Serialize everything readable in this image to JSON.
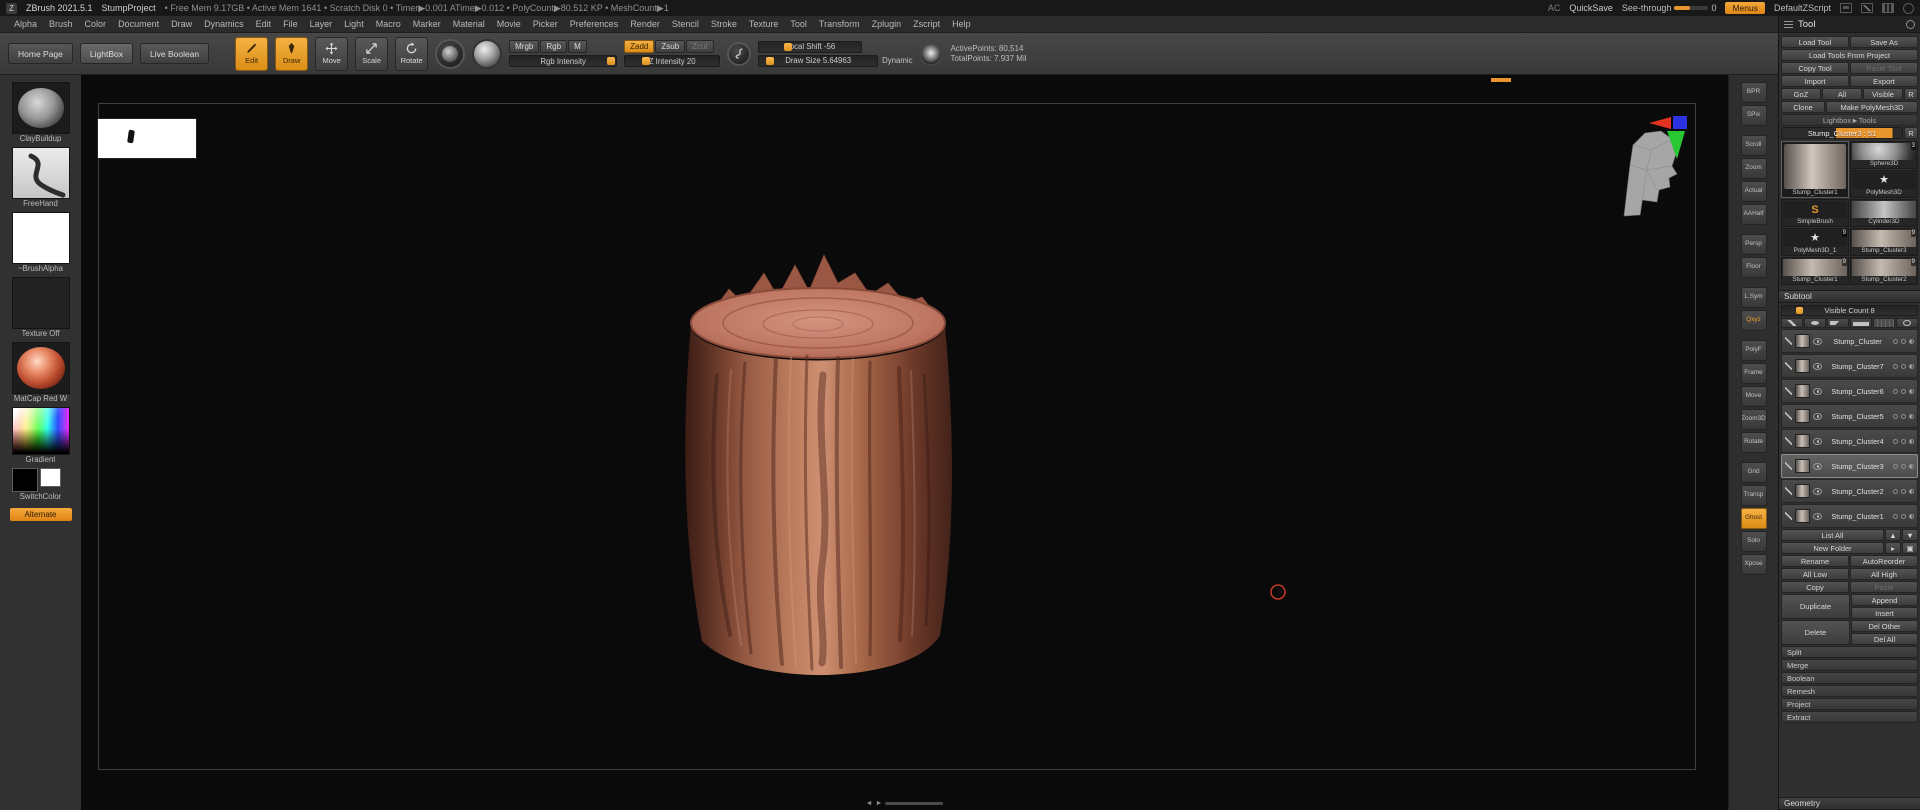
{
  "colors": {
    "accent": "#e8952e",
    "canvas_bg": "#0a0a0a",
    "model_color": "#b5704f"
  },
  "titlebar": {
    "logo": "Z",
    "app_title": "ZBrush 2021.5.1",
    "project": "StumpProject",
    "stats": "• Free Mem 9.17GB • Active Mem 1641 • Scratch Disk 0 • Timer▶0.001 ATime▶0.012 • PolyCount▶80.512 KP • MeshCount▶1",
    "ac": "AC",
    "quicksave": "QuickSave",
    "see_through": "See-through",
    "see_through_value": "0",
    "menus": "Menus",
    "default_zscript": "DefaultZScript"
  },
  "menubar": {
    "items": [
      {
        "label": "Alpha"
      },
      {
        "label": "Brush"
      },
      {
        "label": "Color"
      },
      {
        "label": "Document"
      },
      {
        "label": "Draw"
      },
      {
        "label": "Dynamics"
      },
      {
        "label": "Edit"
      },
      {
        "label": "File"
      },
      {
        "label": "Layer"
      },
      {
        "label": "Light"
      },
      {
        "label": "Macro"
      },
      {
        "label": "Marker"
      },
      {
        "label": "Material"
      },
      {
        "label": "Movie"
      },
      {
        "label": "Picker"
      },
      {
        "label": "Preferences"
      },
      {
        "label": "Render"
      },
      {
        "label": "Stencil"
      },
      {
        "label": "Stroke"
      },
      {
        "label": "Texture"
      },
      {
        "label": "Tool"
      },
      {
        "label": "Transform"
      },
      {
        "label": "Zplugin"
      },
      {
        "label": "Zscript"
      },
      {
        "label": "Help"
      }
    ]
  },
  "toolbar": {
    "home_page": "Home Page",
    "lightbox": "LightBox",
    "live_boolean": "Live Boolean",
    "modes": [
      {
        "label": "Edit",
        "state": "active"
      },
      {
        "label": "Draw",
        "state": "active"
      },
      {
        "label": "Move",
        "state": ""
      },
      {
        "label": "Scale",
        "state": ""
      },
      {
        "label": "Rotate",
        "state": ""
      }
    ],
    "mrgb": "Mrgb",
    "rgb": "Rgb",
    "m": "M",
    "rgb_intensity": "Rgb Intensity",
    "zadd": "Zadd",
    "zsub": "Zsub",
    "zcut": "Zcut",
    "z_intensity": "Z Intensity 20",
    "focal_shift": "Focal Shift -56",
    "draw_size": "Draw Size 5.64963",
    "dynamic": "Dynamic",
    "active_points": "ActivePoints: 80,514",
    "total_points": "TotalPoints: 7.937 Mil"
  },
  "left_shelf": {
    "items": [
      {
        "label": "ClayBuildup"
      },
      {
        "label": "FreeHand"
      },
      {
        "label": "~BrushAlpha"
      },
      {
        "label": "Texture Off"
      },
      {
        "label": "MatCap Red W"
      },
      {
        "label": "Gradient"
      },
      {
        "label": "SwitchColor"
      },
      {
        "label": "Alternate"
      }
    ]
  },
  "right_shelf": {
    "items": [
      {
        "label": "BPR",
        "cls": ""
      },
      {
        "label": "SPix",
        "cls": ""
      },
      {
        "label": "Scroll",
        "cls": "gap"
      },
      {
        "label": "Zoom",
        "cls": ""
      },
      {
        "label": "Actual",
        "cls": ""
      },
      {
        "label": "AAHalf",
        "cls": ""
      },
      {
        "label": "Persp",
        "cls": "gap"
      },
      {
        "label": "Floor",
        "cls": ""
      },
      {
        "label": "L.Sym",
        "cls": "gap"
      },
      {
        "label": "Qxyz",
        "cls": "orange-text"
      },
      {
        "label": "PolyF",
        "cls": "gap"
      },
      {
        "label": "Frame",
        "cls": ""
      },
      {
        "label": "Move",
        "cls": ""
      },
      {
        "label": "Zoom3D",
        "cls": ""
      },
      {
        "label": "Rotate",
        "cls": ""
      },
      {
        "label": "Grid",
        "cls": "gap"
      },
      {
        "label": "Transp",
        "cls": ""
      },
      {
        "label": "Ghost",
        "cls": "active"
      },
      {
        "label": "Solo",
        "cls": ""
      },
      {
        "label": "Xpose",
        "cls": ""
      }
    ]
  },
  "tool_panel": {
    "title": "Tool",
    "load_tool": "Load Tool",
    "save_as": "Save As",
    "load_tools_from_project": "Load Tools From Project",
    "copy_tool": "Copy Tool",
    "paste_tool": "Paste Tool",
    "import": "Import",
    "export": "Export",
    "goz": "GoZ",
    "all": "All",
    "visible": "Visible",
    "r": "R",
    "clone": "Clone",
    "make_polymesh": "Make PolyMesh3D",
    "lightbox_tools": "Lightbox►Tools",
    "inventory_slider": "Stump_Cluster3 : 51",
    "current_tool": {
      "label": "Stump_Cluster1"
    },
    "inventory": [
      {
        "label": "Sphere3D",
        "kind": "sphere",
        "badge": "3"
      },
      {
        "label": "PolyMesh3D",
        "kind": "star",
        "badge": ""
      },
      {
        "label": "SimpleBrush",
        "kind": "sbrush",
        "badge": ""
      },
      {
        "label": "Cylinder3D",
        "kind": "cylinder",
        "badge": ""
      },
      {
        "label": "PolyMesh3D_1",
        "kind": "star",
        "badge": "9"
      },
      {
        "label": "Stump_Cluster3",
        "kind": "stump",
        "badge": "9"
      },
      {
        "label": "Stump_Cluster1",
        "kind": "stump",
        "badge": "9"
      },
      {
        "label": "Stump_Cluster2",
        "kind": "stump",
        "badge": "9"
      }
    ],
    "subtool": {
      "title": "Subtool",
      "visible_count": "Visible Count 8",
      "items": [
        {
          "label": "Stump_Cluster",
          "state": ""
        },
        {
          "label": "Stump_Cluster7",
          "state": ""
        },
        {
          "label": "Stump_Cluster6",
          "state": ""
        },
        {
          "label": "Stump_Cluster5",
          "state": ""
        },
        {
          "label": "Stump_Cluster4",
          "state": ""
        },
        {
          "label": "Stump_Cluster3",
          "state": "selected"
        },
        {
          "label": "Stump_Cluster2",
          "state": ""
        },
        {
          "label": "Stump_Cluster1",
          "state": ""
        }
      ],
      "list_all": "List All",
      "up_arrow": "▲",
      "down_arrow": "▼",
      "new_folder": "New Folder",
      "rename": "Rename",
      "autoreorder": "AutoReorder",
      "all_low": "All Low",
      "all_high": "All High",
      "copy": "Copy",
      "paste": "Paste",
      "duplicate": "Duplicate",
      "append": "Append",
      "insert": "Insert",
      "delete": "Delete",
      "del_other": "Del Other",
      "del_all": "Del All",
      "split": "Split",
      "merge": "Merge",
      "boolean": "Boolean",
      "remesh": "Remesh",
      "project": "Project",
      "extract": "Extract"
    },
    "geometry": "Geometry"
  }
}
